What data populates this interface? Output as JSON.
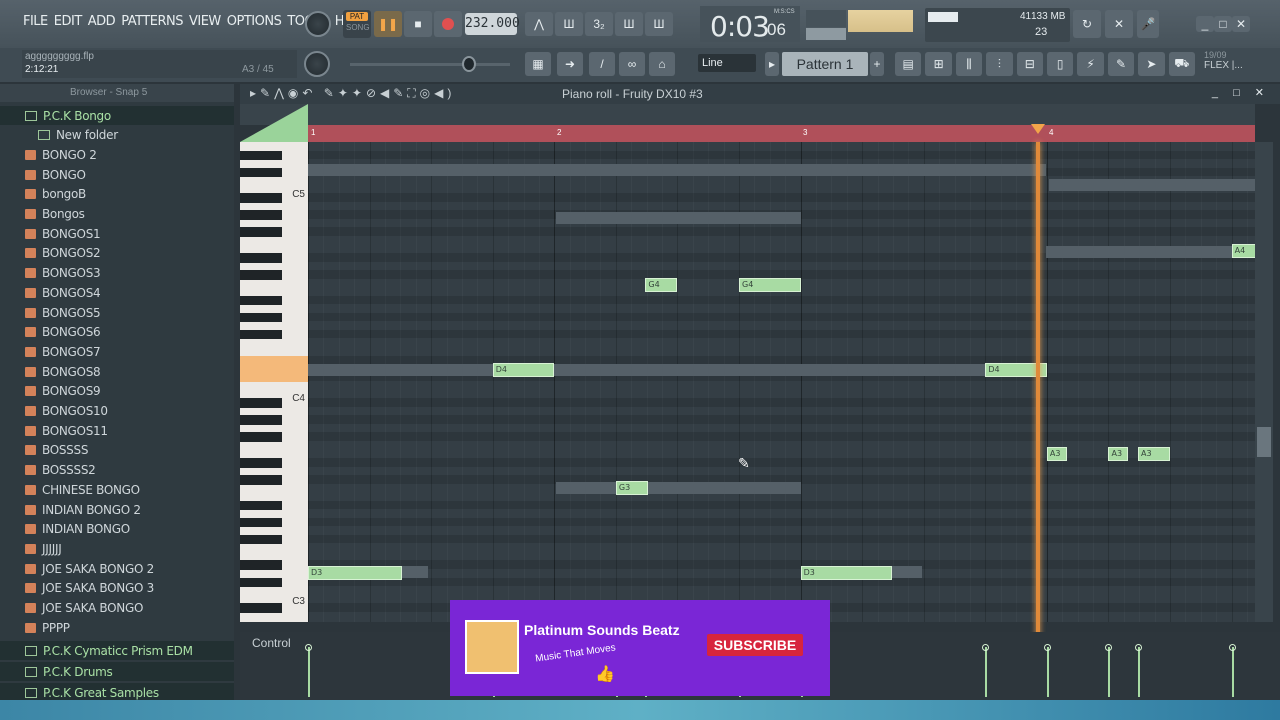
{
  "menu": [
    "FILE",
    "EDIT",
    "ADD",
    "PATTERNS",
    "VIEW",
    "OPTIONS",
    "TOOLS",
    "HELP"
  ],
  "transport": {
    "pat_label": "PAT",
    "song_label": "SONG",
    "tempo": "232.000",
    "time": "0:03",
    "time_ticks": "06",
    "time_unit": "M:S:CS"
  },
  "monitor": {
    "cpu": "41",
    "ram": "133 MB",
    "voices": "23"
  },
  "project": {
    "filename": "aggggggggg.flp",
    "position": "2:12:21",
    "pattern_pos": "A3 / 45"
  },
  "toolbar": {
    "snap_mode": "Line",
    "pattern_name": "Pattern 1",
    "date": "19/09",
    "flex": "FLEX |..."
  },
  "browser": {
    "header": "Browser - Snap 5",
    "items": [
      {
        "label": "P.C.K Bongo",
        "type": "group"
      },
      {
        "label": "New folder",
        "type": "folder"
      },
      {
        "label": "BONGO 2",
        "type": "file"
      },
      {
        "label": "BONGO",
        "type": "file"
      },
      {
        "label": "bongoB",
        "type": "file"
      },
      {
        "label": "Bongos",
        "type": "file"
      },
      {
        "label": "BONGOS1",
        "type": "file"
      },
      {
        "label": "BONGOS2",
        "type": "file"
      },
      {
        "label": "BONGOS3",
        "type": "file"
      },
      {
        "label": "BONGOS4",
        "type": "file"
      },
      {
        "label": "BONGOS5",
        "type": "file"
      },
      {
        "label": "BONGOS6",
        "type": "file"
      },
      {
        "label": "BONGOS7",
        "type": "file"
      },
      {
        "label": "BONGOS8",
        "type": "file"
      },
      {
        "label": "BONGOS9",
        "type": "file"
      },
      {
        "label": "BONGOS10",
        "type": "file"
      },
      {
        "label": "BONGOS11",
        "type": "file"
      },
      {
        "label": "BOSSSS",
        "type": "file"
      },
      {
        "label": "BOSSSS2",
        "type": "file"
      },
      {
        "label": "CHINESE BONGO",
        "type": "file"
      },
      {
        "label": "INDIAN BONGO 2",
        "type": "file"
      },
      {
        "label": "INDIAN BONGO",
        "type": "file"
      },
      {
        "label": "JJJJJJ",
        "type": "file"
      },
      {
        "label": "JOE SAKA BONGO 2",
        "type": "file"
      },
      {
        "label": "JOE SAKA BONGO 3",
        "type": "file"
      },
      {
        "label": "JOE SAKA BONGO",
        "type": "file"
      },
      {
        "label": "PPPP",
        "type": "file"
      },
      {
        "label": "P.C.K Cymaticc Prism EDM",
        "type": "group"
      },
      {
        "label": "P.C.K Drums",
        "type": "group"
      },
      {
        "label": "P.C.K Great Samples",
        "type": "group"
      }
    ]
  },
  "piano_roll": {
    "title": "Piano roll - Fruity DX10 #3",
    "bars": [
      "1",
      "2",
      "3",
      "4"
    ],
    "key_labels": [
      "C5",
      "C4",
      "C3"
    ],
    "notes": [
      {
        "label": "G4",
        "bar": 2.37,
        "len": 0.13,
        "row": "G4"
      },
      {
        "label": "G4",
        "bar": 2.75,
        "len": 0.25,
        "row": "G4"
      },
      {
        "label": "D4",
        "bar": 1.75,
        "len": 0.25,
        "row": "D4"
      },
      {
        "label": "D4",
        "bar": 3.75,
        "len": 0.25,
        "row": "D4"
      },
      {
        "label": "A4",
        "bar": 4.75,
        "len": 0.1,
        "row": "A4"
      },
      {
        "label": "A3",
        "bar": 4.0,
        "len": 0.08,
        "row": "A3"
      },
      {
        "label": "A3",
        "bar": 4.25,
        "len": 0.08,
        "row": "A3"
      },
      {
        "label": "A3",
        "bar": 4.37,
        "len": 0.13,
        "row": "A3"
      },
      {
        "label": "G3",
        "bar": 2.25,
        "len": 0.13,
        "row": "G3"
      },
      {
        "label": "D3",
        "bar": 1.0,
        "len": 0.38,
        "row": "D3"
      },
      {
        "label": "D3",
        "bar": 3.0,
        "len": 0.37,
        "row": "D3"
      }
    ],
    "control_label": "Control"
  },
  "ad": {
    "channel": "Platinum Sounds Beatz",
    "tagline": "Music That Moves",
    "subscribe": "SUBSCRIBE"
  }
}
